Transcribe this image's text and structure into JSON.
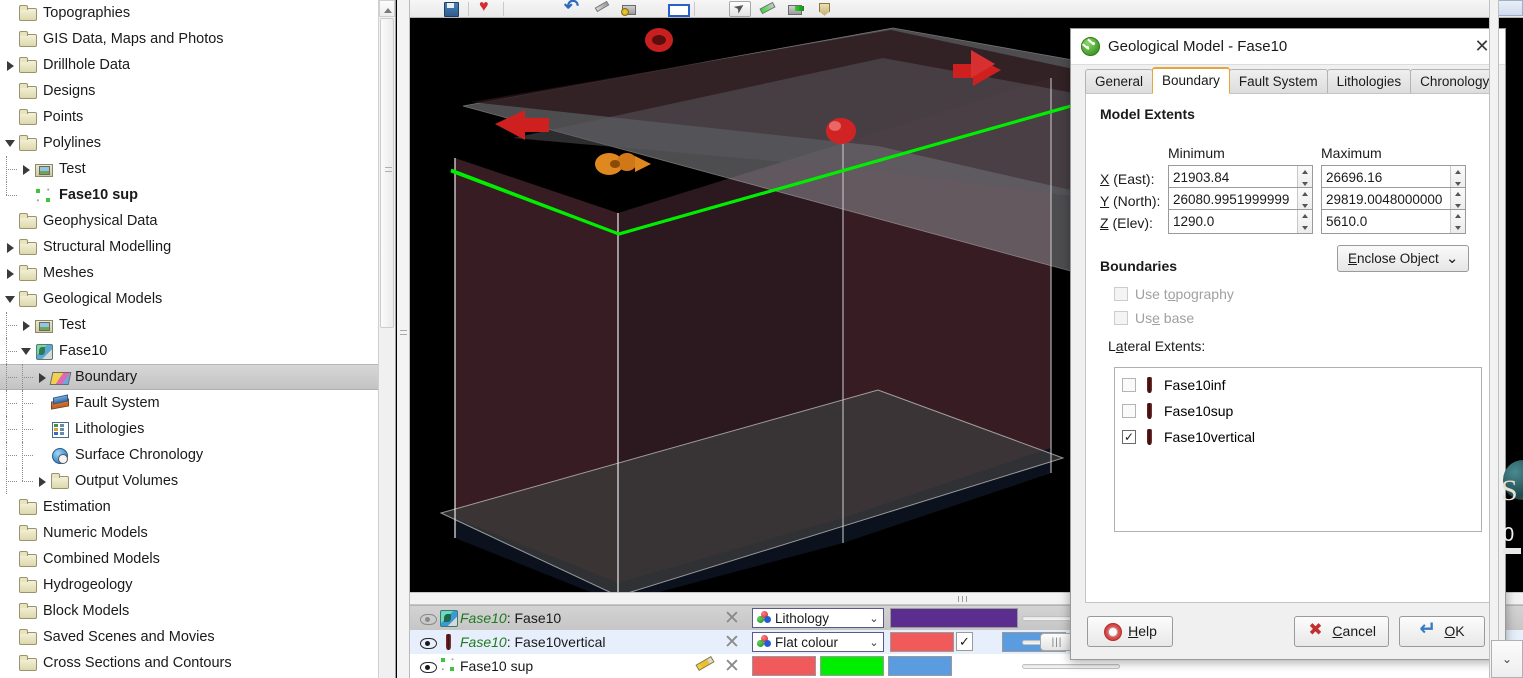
{
  "tree": {
    "items": [
      {
        "label": "Topographies",
        "icon": "folder",
        "twisty": "none",
        "indent": 0,
        "guide": "none",
        "selected": false,
        "bold": false
      },
      {
        "label": "GIS Data, Maps and Photos",
        "icon": "folder",
        "twisty": "none",
        "indent": 0,
        "guide": "none",
        "selected": false,
        "bold": false
      },
      {
        "label": "Drillhole Data",
        "icon": "folder",
        "twisty": "closed",
        "indent": 0,
        "guide": "none",
        "selected": false,
        "bold": false
      },
      {
        "label": "Designs",
        "icon": "folder",
        "twisty": "none",
        "indent": 0,
        "guide": "none",
        "selected": false,
        "bold": false
      },
      {
        "label": "Points",
        "icon": "folder",
        "twisty": "none",
        "indent": 0,
        "guide": "none",
        "selected": false,
        "bold": false
      },
      {
        "label": "Polylines",
        "icon": "folder",
        "twisty": "open",
        "indent": 0,
        "guide": "none",
        "selected": false,
        "bold": false
      },
      {
        "label": "Test",
        "icon": "folder-pic",
        "twisty": "closed",
        "indent": 1,
        "guide": "v",
        "selected": false,
        "bold": false
      },
      {
        "label": "Fase10 sup",
        "icon": "polyline",
        "twisty": "none",
        "indent": 1,
        "guide": "vhalf",
        "selected": false,
        "bold": true
      },
      {
        "label": "Geophysical Data",
        "icon": "folder",
        "twisty": "none",
        "indent": 0,
        "guide": "none",
        "selected": false,
        "bold": false
      },
      {
        "label": "Structural Modelling",
        "icon": "folder",
        "twisty": "closed",
        "indent": 0,
        "guide": "none",
        "selected": false,
        "bold": false
      },
      {
        "label": "Meshes",
        "icon": "folder",
        "twisty": "closed",
        "indent": 0,
        "guide": "none",
        "selected": false,
        "bold": false
      },
      {
        "label": "Geological Models",
        "icon": "folder",
        "twisty": "open",
        "indent": 0,
        "guide": "none",
        "selected": false,
        "bold": false
      },
      {
        "label": "Test",
        "icon": "folder-pic",
        "twisty": "closed",
        "indent": 1,
        "guide": "v",
        "selected": false,
        "bold": false
      },
      {
        "label": "Fase10",
        "icon": "geomodel",
        "twisty": "open",
        "indent": 1,
        "guide": "v",
        "selected": false,
        "bold": false
      },
      {
        "label": "Boundary",
        "icon": "boundary",
        "twisty": "closed",
        "indent": 2,
        "guide": "v",
        "selected": true,
        "bold": false
      },
      {
        "label": "Fault System",
        "icon": "fault",
        "twisty": "none",
        "indent": 2,
        "guide": "v",
        "selected": false,
        "bold": false
      },
      {
        "label": "Lithologies",
        "icon": "litho",
        "twisty": "none",
        "indent": 2,
        "guide": "v",
        "selected": false,
        "bold": false
      },
      {
        "label": "Surface Chronology",
        "icon": "chrono",
        "twisty": "none",
        "indent": 2,
        "guide": "v",
        "selected": false,
        "bold": false
      },
      {
        "label": "Output Volumes",
        "icon": "folder",
        "twisty": "closed",
        "indent": 2,
        "guide": "vhalf",
        "selected": false,
        "bold": false
      },
      {
        "label": "Estimation",
        "icon": "folder",
        "twisty": "none",
        "indent": 0,
        "guide": "none",
        "selected": false,
        "bold": false
      },
      {
        "label": "Numeric Models",
        "icon": "folder",
        "twisty": "none",
        "indent": 0,
        "guide": "none",
        "selected": false,
        "bold": false
      },
      {
        "label": "Combined Models",
        "icon": "folder",
        "twisty": "none",
        "indent": 0,
        "guide": "none",
        "selected": false,
        "bold": false
      },
      {
        "label": "Hydrogeology",
        "icon": "folder",
        "twisty": "none",
        "indent": 0,
        "guide": "none",
        "selected": false,
        "bold": false
      },
      {
        "label": "Block Models",
        "icon": "folder",
        "twisty": "none",
        "indent": 0,
        "guide": "none",
        "selected": false,
        "bold": false
      },
      {
        "label": "Saved Scenes and Movies",
        "icon": "folder",
        "twisty": "none",
        "indent": 0,
        "guide": "none",
        "selected": false,
        "bold": false
      },
      {
        "label": "Cross Sections and Contours",
        "icon": "folder",
        "twisty": "none",
        "indent": 0,
        "guide": "none",
        "selected": false,
        "bold": false
      }
    ]
  },
  "toolbar": {
    "icons": [
      "save-icon",
      "heart-icon",
      "undo-arrow-icon",
      "pencil-icon",
      "tool-yellow-icon",
      "rectangle-icon",
      "cursor-icon",
      "green-pencil-icon",
      "green-tool-icon",
      "stamp-icon"
    ]
  },
  "viewport": {
    "background_color": "#000000",
    "boundary_outline_color": "#00EE00",
    "axis_arrow_color": "#E040E0",
    "handle_color": "#D02020",
    "rotate_handle_color": "#E08820",
    "box_fill_color": "#3A1A22",
    "topography_color": "#9A9AA0"
  },
  "dialog": {
    "title": "Geological Model - Fase10",
    "app_icon": "geological-model-icon",
    "close_label": "✕",
    "tabs": [
      {
        "label": "General",
        "active": false
      },
      {
        "label": "Boundary",
        "active": true
      },
      {
        "label": "Fault System",
        "active": false
      },
      {
        "label": "Lithologies",
        "active": false
      },
      {
        "label": "Chronology",
        "active": false
      }
    ],
    "model_extents": {
      "section_title": "Model Extents",
      "col_minimum": "Minimum",
      "col_maximum": "Maximum",
      "rows": [
        {
          "label_underline": "X",
          "label_rest": " (East):",
          "min": "21903.84",
          "max": "26696.16"
        },
        {
          "label_underline": "Y",
          "label_rest": " (North):",
          "min": "26080.9951999999",
          "max": "29819.0048000000"
        },
        {
          "label_underline": "Z",
          "label_rest": " (Elev):",
          "min": "1290.0",
          "max": "5610.0"
        }
      ],
      "enclose_button": "Enclose Object",
      "enclose_chevron": "⌄"
    },
    "boundaries": {
      "section_title": "Boundaries",
      "checkboxes": [
        {
          "label": "Use topography",
          "checked": false,
          "disabled": true
        },
        {
          "label": "Use base",
          "checked": false,
          "disabled": true
        }
      ],
      "lateral_label": "Lateral Extents:",
      "lateral_extents": [
        {
          "label": "Fase10inf",
          "checked": false
        },
        {
          "label": "Fase10sup",
          "checked": false
        },
        {
          "label": "Fase10vertical",
          "checked": true
        }
      ]
    },
    "footer": {
      "help": "Help",
      "cancel": "Cancel",
      "ok": "OK"
    }
  },
  "scene_list": {
    "rows": [
      {
        "name_prefix": "Fase10",
        "name_suffix": ": Fase10",
        "icon": "geological-model-icon",
        "visible": true,
        "selected_style": "grey",
        "has_pencil": false,
        "colour_mode": "Lithology",
        "swatches": [
          "#5B2D8E"
        ],
        "extra_checkbox": false,
        "slider_style": "thin"
      },
      {
        "name_prefix": "Fase10",
        "name_suffix": ": Fase10vertical",
        "icon": "lateral-extent-icon",
        "visible": true,
        "selected_style": "blue",
        "has_pencil": false,
        "colour_mode": "Flat colour",
        "swatches": [
          "#F05A5A",
          "#5B9BE0"
        ],
        "extra_checkbox": true,
        "slider_style": "knob"
      },
      {
        "name_prefix": "",
        "name_suffix": "Fase10 sup",
        "icon": "polyline-icon",
        "visible": true,
        "selected_style": "none",
        "has_pencil": true,
        "colour_mode": "",
        "swatches": [
          "#F05A5A",
          "#00EE00",
          "#5B9BE0"
        ],
        "extra_checkbox": false,
        "slider_style": "thin"
      }
    ]
  },
  "edge": {
    "s_glyph": "S",
    "zero_glyph": "0",
    "chevron": "⌄"
  }
}
